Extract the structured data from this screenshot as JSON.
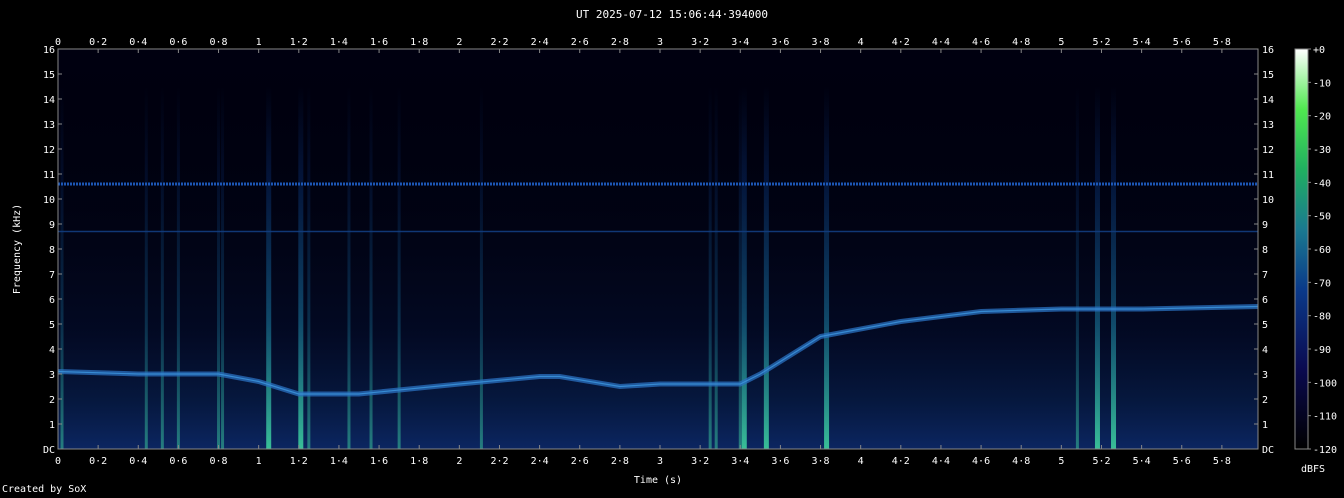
{
  "title": "UT 2025-07-12 15:06:44·394000",
  "footer": "Created by SoX",
  "chart_data": {
    "type": "heatmap",
    "title": "UT 2025-07-12 15:06:44·394000",
    "xlabel": "Time (s)",
    "ylabel": "Frequency (kHz)",
    "colorbar_label": "dBFS",
    "xlim": [
      0,
      5.98
    ],
    "ylim": [
      0,
      16
    ],
    "x_ticks": [
      "0",
      "0·2",
      "0·4",
      "0·6",
      "0·8",
      "1",
      "1·2",
      "1·4",
      "1·6",
      "1·8",
      "2",
      "2·2",
      "2·4",
      "2·6",
      "2·8",
      "3",
      "3·2",
      "3·4",
      "3·6",
      "3·8",
      "4",
      "4·2",
      "4·4",
      "4·6",
      "4·8",
      "5",
      "5·2",
      "5·4",
      "5·6",
      "5·8"
    ],
    "y_ticks": [
      "DC",
      "1",
      "2",
      "3",
      "4",
      "5",
      "6",
      "7",
      "8",
      "9",
      "10",
      "11",
      "12",
      "13",
      "14",
      "15",
      "16"
    ],
    "colorbar_ticks": [
      "+0",
      "-10",
      "-20",
      "-30",
      "-40",
      "-50",
      "-60",
      "-70",
      "-80",
      "-90",
      "-100",
      "-110",
      "-120"
    ],
    "colorbar_range": [
      -120,
      0
    ],
    "colors": {
      "background": "#000000",
      "low": "#000018",
      "mid": "#0a3a8a",
      "high_mid": "#1a9a80",
      "high": "#50e850",
      "peak": "#ffffff"
    },
    "tone_line": {
      "time_s": [
        0,
        0.4,
        0.8,
        1.0,
        1.2,
        1.5,
        2.0,
        2.4,
        2.5,
        2.8,
        3.0,
        3.4,
        3.5,
        3.8,
        4.2,
        4.6,
        5.0,
        5.4,
        5.98
      ],
      "freq_khz": [
        3.1,
        3.0,
        3.0,
        2.7,
        2.2,
        2.2,
        2.6,
        2.9,
        2.9,
        2.5,
        2.6,
        2.6,
        3.0,
        4.5,
        5.1,
        5.5,
        5.6,
        5.6,
        5.7
      ]
    },
    "steady_tones_khz": [
      10.6,
      8.7
    ],
    "transients_s": [
      0.02,
      0.44,
      0.52,
      0.6,
      0.8,
      0.82,
      1.05,
      1.21,
      1.25,
      1.45,
      1.56,
      1.7,
      2.11,
      3.25,
      3.28,
      3.4,
      3.42,
      3.53,
      3.83,
      5.08,
      5.18,
      5.26
    ]
  }
}
